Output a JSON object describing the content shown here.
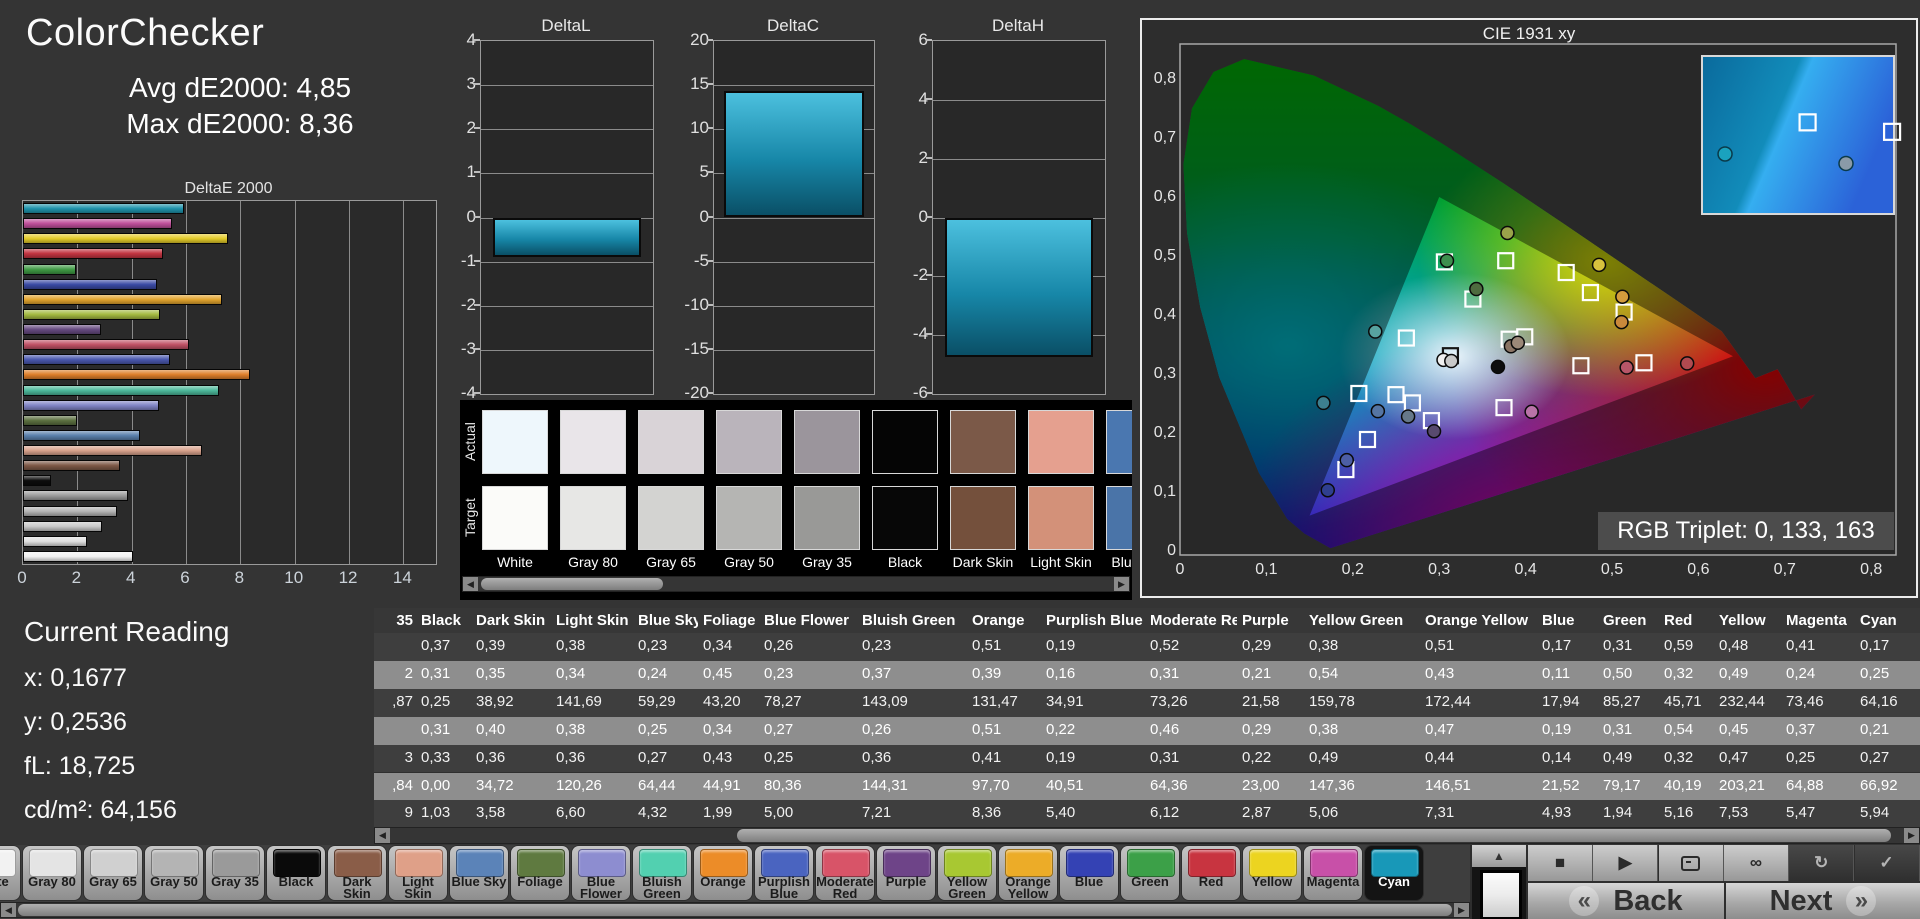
{
  "header": {
    "title": "ColorChecker",
    "avg_label": "Avg dE2000: 4,85",
    "max_label": "Max dE2000: 8,36"
  },
  "current_reading": {
    "title": "Current Reading",
    "lines": [
      "x: 0,1677",
      "y: 0,2536",
      "fL: 18,725",
      "cd/m²: 64,156"
    ]
  },
  "chart_data": [
    {
      "id": "deltaE2000",
      "type": "bar",
      "orientation": "horizontal",
      "title": "DeltaE 2000",
      "xlim": [
        0,
        15.2
      ],
      "xticks": [
        0,
        2,
        4,
        6,
        8,
        10,
        12,
        14
      ],
      "series": [
        {
          "name": "Cyan",
          "value": 5.94,
          "color": "#1f93ac"
        },
        {
          "name": "Magenta",
          "value": 5.47,
          "color": "#bf4f9a"
        },
        {
          "name": "Yellow",
          "value": 7.53,
          "color": "#e3cb2a"
        },
        {
          "name": "Red",
          "value": 5.16,
          "color": "#c23440"
        },
        {
          "name": "Green",
          "value": 1.94,
          "color": "#3f9a44"
        },
        {
          "name": "Blue",
          "value": 4.93,
          "color": "#3a4aa4"
        },
        {
          "name": "Orange Yellow",
          "value": 7.31,
          "color": "#e2a42e"
        },
        {
          "name": "Yellow Green",
          "value": 5.06,
          "color": "#a4ba40"
        },
        {
          "name": "Purple",
          "value": 2.87,
          "color": "#664a80"
        },
        {
          "name": "Moderate Red",
          "value": 6.12,
          "color": "#c05266"
        },
        {
          "name": "Purplish Blue",
          "value": 5.4,
          "color": "#4a58ae"
        },
        {
          "name": "Orange",
          "value": 8.36,
          "color": "#df7f2b"
        },
        {
          "name": "Bluish Green",
          "value": 7.21,
          "color": "#4cb89a"
        },
        {
          "name": "Blue Flower",
          "value": 5.0,
          "color": "#8084c4"
        },
        {
          "name": "Foliage",
          "value": 1.99,
          "color": "#5c7040"
        },
        {
          "name": "Blue Sky",
          "value": 4.32,
          "color": "#5a80ac"
        },
        {
          "name": "Light Skin",
          "value": 6.6,
          "color": "#d8a28c"
        },
        {
          "name": "Dark Skin",
          "value": 3.58,
          "color": "#7d5846"
        },
        {
          "name": "Black",
          "value": 1.03,
          "color": "#0d0d0d"
        },
        {
          "name": "Gray 35",
          "value": 3.85,
          "color": "#9c9c9c"
        },
        {
          "name": "Gray 50",
          "value": 3.45,
          "color": "#b2b2b2"
        },
        {
          "name": "Gray 65",
          "value": 2.9,
          "color": "#c8c8c8"
        },
        {
          "name": "Gray 80",
          "value": 2.35,
          "color": "#dedede"
        },
        {
          "name": "White",
          "value": 4.05,
          "color": "#f2f2f2"
        }
      ]
    },
    {
      "id": "deltaL",
      "type": "bar",
      "title": "DeltaL",
      "ylim": [
        -4,
        4
      ],
      "yticks": [
        4,
        3,
        2,
        1,
        0,
        -1,
        -2,
        -3,
        -4
      ],
      "value": -0.9
    },
    {
      "id": "deltaC",
      "type": "bar",
      "title": "DeltaC",
      "ylim": [
        -20,
        20
      ],
      "yticks": [
        20,
        15,
        10,
        5,
        0,
        -5,
        -10,
        -15,
        -20
      ],
      "value": 14.3
    },
    {
      "id": "deltaH",
      "type": "bar",
      "title": "DeltaH",
      "ylim": [
        -6,
        6
      ],
      "yticks": [
        6,
        4,
        2,
        0,
        -2,
        -4,
        -6
      ],
      "value": -4.75
    },
    {
      "id": "cie1931",
      "type": "scatter",
      "title": "CIE 1931 xy",
      "xlim": [
        0,
        0.8
      ],
      "ylim": [
        0,
        0.8
      ],
      "xtick_labels": [
        "0",
        "0,1",
        "0,2",
        "0,3",
        "0,4",
        "0,5",
        "0,6",
        "0,7",
        "0,8"
      ],
      "ytick_labels": [
        "0",
        "0,1",
        "0,2",
        "0,3",
        "0,4",
        "0,5",
        "0,6",
        "0,7",
        "0,8"
      ],
      "annotation": "RGB Triplet: 0, 133, 163",
      "gamut_triangle": [
        [
          0.64,
          0.33
        ],
        [
          0.3,
          0.6
        ],
        [
          0.15,
          0.06
        ]
      ],
      "targets": [
        [
          0.313,
          0.331
        ],
        [
          0.306,
          0.49
        ],
        [
          0.377,
          0.492
        ],
        [
          0.339,
          0.427
        ],
        [
          0.447,
          0.472
        ],
        [
          0.475,
          0.438
        ],
        [
          0.514,
          0.405
        ],
        [
          0.399,
          0.363
        ],
        [
          0.381,
          0.359
        ],
        [
          0.464,
          0.314
        ],
        [
          0.537,
          0.319
        ],
        [
          0.262,
          0.361
        ],
        [
          0.207,
          0.267
        ],
        [
          0.25,
          0.265
        ],
        [
          0.269,
          0.251
        ],
        [
          0.291,
          0.221
        ],
        [
          0.217,
          0.189
        ],
        [
          0.192,
          0.138
        ],
        [
          0.375,
          0.243
        ]
      ],
      "measurements": [
        {
          "x": 0.379,
          "y": 0.539,
          "color": "#9aa34a"
        },
        {
          "x": 0.309,
          "y": 0.492,
          "color": "#3d8f4e"
        },
        {
          "x": 0.343,
          "y": 0.444,
          "color": "#4e6b3f"
        },
        {
          "x": 0.485,
          "y": 0.485,
          "color": "#d8c23e"
        },
        {
          "x": 0.512,
          "y": 0.431,
          "color": "#d49c3c"
        },
        {
          "x": 0.511,
          "y": 0.388,
          "color": "#c9893b"
        },
        {
          "x": 0.226,
          "y": 0.372,
          "color": "#57a3a0"
        },
        {
          "x": 0.383,
          "y": 0.347,
          "color": "#8a7464"
        },
        {
          "x": 0.391,
          "y": 0.353,
          "color": "#9b8878"
        },
        {
          "x": 0.305,
          "y": 0.324,
          "color": "#f0f0f0"
        },
        {
          "x": 0.314,
          "y": 0.322,
          "color": "#c9c9c9"
        },
        {
          "x": 0.368,
          "y": 0.312,
          "color": "#0d0d0d"
        },
        {
          "x": 0.517,
          "y": 0.311,
          "color": "#b75668"
        },
        {
          "x": 0.587,
          "y": 0.318,
          "color": "#b04a50"
        },
        {
          "x": 0.166,
          "y": 0.251,
          "color": "#3d7f8f"
        },
        {
          "x": 0.229,
          "y": 0.237,
          "color": "#5575a3"
        },
        {
          "x": 0.264,
          "y": 0.228,
          "color": "#66788a"
        },
        {
          "x": 0.294,
          "y": 0.203,
          "color": "#584a6e"
        },
        {
          "x": 0.193,
          "y": 0.154,
          "color": "#4c5ea5"
        },
        {
          "x": 0.171,
          "y": 0.103,
          "color": "#2f3f8f"
        },
        {
          "x": 0.407,
          "y": 0.236,
          "color": "#b973a8"
        }
      ],
      "inset_markers": [
        {
          "type": "circle",
          "fx": 0.12,
          "fy": 0.62,
          "color": "#1aa2be"
        },
        {
          "type": "square",
          "fx": 0.55,
          "fy": 0.42,
          "color": "none"
        },
        {
          "type": "square",
          "fx": 0.99,
          "fy": 0.48,
          "color": "none"
        },
        {
          "type": "circle",
          "fx": 0.75,
          "fy": 0.68,
          "color": "#8a9aa8"
        }
      ]
    }
  ],
  "swatch_panel": {
    "row_labels": [
      "Actual",
      "Target"
    ],
    "columns": [
      {
        "name": "White",
        "actual": "#eef7fc",
        "target": "#fbfbf9"
      },
      {
        "name": "Gray 80",
        "actual": "#e9e5e9",
        "target": "#e7e7e5"
      },
      {
        "name": "Gray 65",
        "actual": "#d9d3d7",
        "target": "#d3d3d1"
      },
      {
        "name": "Gray 50",
        "actual": "#bab4bb",
        "target": "#b5b5b3"
      },
      {
        "name": "Gray 35",
        "actual": "#9b959c",
        "target": "#999997"
      },
      {
        "name": "Black",
        "actual": "#050505",
        "target": "#070707"
      },
      {
        "name": "Dark Skin",
        "actual": "#7b5948",
        "target": "#74503c"
      },
      {
        "name": "Light Skin",
        "actual": "#e5a08f",
        "target": "#d39179"
      },
      {
        "name": "Blue Sky",
        "actual": "#4a77b0",
        "target": "#4a74a8"
      }
    ]
  },
  "table": {
    "headers": [
      "35",
      "Black",
      "Dark Skin",
      "Light Skin",
      "Blue Sky",
      "Foliage",
      "Blue Flower",
      "Bluish Green",
      "Orange",
      "Purplish Blue",
      "Moderate Red",
      "Purple",
      "Yellow Green",
      "Orange Yellow",
      "Blue",
      "Green",
      "Red",
      "Yellow",
      "Magenta",
      "Cyan"
    ],
    "rows": [
      [
        "",
        "0,37",
        "0,39",
        "0,38",
        "0,23",
        "0,34",
        "0,26",
        "0,23",
        "0,51",
        "0,19",
        "0,52",
        "0,29",
        "0,38",
        "0,51",
        "0,17",
        "0,31",
        "0,59",
        "0,48",
        "0,41",
        "0,17"
      ],
      [
        "2",
        "0,31",
        "0,35",
        "0,34",
        "0,24",
        "0,45",
        "0,23",
        "0,37",
        "0,39",
        "0,16",
        "0,31",
        "0,21",
        "0,54",
        "0,43",
        "0,11",
        "0,50",
        "0,32",
        "0,49",
        "0,24",
        "0,25"
      ],
      [
        ",87",
        "0,25",
        "38,92",
        "141,69",
        "59,29",
        "43,20",
        "78,27",
        "143,09",
        "131,47",
        "34,91",
        "73,26",
        "21,58",
        "159,78",
        "172,44",
        "17,94",
        "85,27",
        "45,71",
        "232,44",
        "73,46",
        "64,16"
      ],
      [
        "",
        "0,31",
        "0,40",
        "0,38",
        "0,25",
        "0,34",
        "0,27",
        "0,26",
        "0,51",
        "0,22",
        "0,46",
        "0,29",
        "0,38",
        "0,47",
        "0,19",
        "0,31",
        "0,54",
        "0,45",
        "0,37",
        "0,21"
      ],
      [
        "3",
        "0,33",
        "0,36",
        "0,36",
        "0,27",
        "0,43",
        "0,25",
        "0,36",
        "0,41",
        "0,19",
        "0,31",
        "0,22",
        "0,49",
        "0,44",
        "0,14",
        "0,49",
        "0,32",
        "0,47",
        "0,25",
        "0,27"
      ],
      [
        ",84",
        "0,00",
        "34,72",
        "120,26",
        "64,44",
        "44,91",
        "80,36",
        "144,31",
        "97,70",
        "40,51",
        "64,36",
        "23,00",
        "147,36",
        "146,51",
        "21,52",
        "79,17",
        "40,19",
        "203,21",
        "64,88",
        "66,92"
      ],
      [
        "9",
        "1,03",
        "3,58",
        "6,60",
        "4,32",
        "1,99",
        "5,00",
        "7,21",
        "8,36",
        "5,40",
        "6,12",
        "2,87",
        "5,06",
        "7,31",
        "4,93",
        "1,94",
        "5,16",
        "7,53",
        "5,47",
        "5,94"
      ]
    ]
  },
  "patch_strip": {
    "items": [
      {
        "label": "White",
        "color": "#f2f2f2",
        "selected": false
      },
      {
        "label": "Gray 80",
        "color": "#e4e4e4",
        "selected": false
      },
      {
        "label": "Gray 65",
        "color": "#d0d0d0",
        "selected": false
      },
      {
        "label": "Gray 50",
        "color": "#b4b4b4",
        "selected": false
      },
      {
        "label": "Gray 35",
        "color": "#9a9a9a",
        "selected": false
      },
      {
        "label": "Black",
        "color": "#0a0a0a",
        "selected": false
      },
      {
        "label": "Dark Skin",
        "color": "#8a5d48",
        "selected": false
      },
      {
        "label": "Light Skin",
        "color": "#dfa088",
        "selected": false
      },
      {
        "label": "Blue Sky",
        "color": "#5b83b8",
        "selected": false
      },
      {
        "label": "Foliage",
        "color": "#5f7a40",
        "selected": false
      },
      {
        "label": "Blue Flower",
        "color": "#8d8dd0",
        "selected": false
      },
      {
        "label": "Bluish Green",
        "color": "#52d0b0",
        "selected": false
      },
      {
        "label": "Orange",
        "color": "#ec8c28",
        "selected": false
      },
      {
        "label": "Purplish Blue",
        "color": "#4a64c0",
        "selected": false
      },
      {
        "label": "Moderate Red",
        "color": "#d85468",
        "selected": false
      },
      {
        "label": "Purple",
        "color": "#6e4488",
        "selected": false
      },
      {
        "label": "Yellow Green",
        "color": "#a8c832",
        "selected": false
      },
      {
        "label": "Orange Yellow",
        "color": "#ecac28",
        "selected": false
      },
      {
        "label": "Blue",
        "color": "#3442b4",
        "selected": false
      },
      {
        "label": "Green",
        "color": "#3ca048",
        "selected": false
      },
      {
        "label": "Red",
        "color": "#c83440",
        "selected": false
      },
      {
        "label": "Yellow",
        "color": "#ecd420",
        "selected": false
      },
      {
        "label": "Magenta",
        "color": "#c850a8",
        "selected": false
      },
      {
        "label": "Cyan",
        "color": "#1898b8",
        "selected": true
      }
    ]
  },
  "transport": {
    "up_glyph": "▲",
    "media_buttons": [
      {
        "name": "stop-icon",
        "glyph": "■",
        "dark": false
      },
      {
        "name": "play-icon",
        "glyph": "▶",
        "dark": false
      },
      {
        "name": "pattern-window-icon",
        "glyph": "",
        "dark": false
      },
      {
        "name": "loop-icon",
        "glyph": "∞",
        "dark": false
      },
      {
        "name": "refresh-icon",
        "glyph": "↻",
        "dark": true
      },
      {
        "name": "confirm-icon",
        "glyph": "✓",
        "dark": true
      }
    ],
    "back_label": "Back",
    "next_label": "Next",
    "back_chevron": "«",
    "next_chevron": "»",
    "scroll_left_glyph": "◀",
    "scroll_right_glyph": "▶"
  }
}
